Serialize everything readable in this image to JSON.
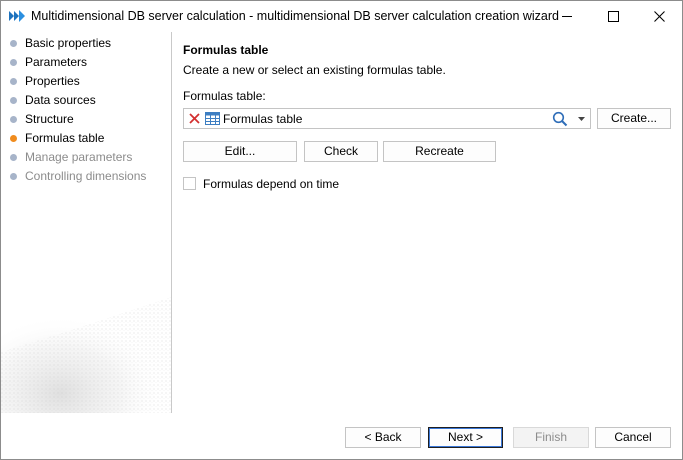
{
  "window": {
    "title": "Multidimensional DB server calculation - multidimensional DB server calculation creation wizard"
  },
  "nav": {
    "items": [
      {
        "label": "Basic properties",
        "state": "normal"
      },
      {
        "label": "Parameters",
        "state": "normal"
      },
      {
        "label": "Properties",
        "state": "normal"
      },
      {
        "label": "Data sources",
        "state": "normal"
      },
      {
        "label": "Structure",
        "state": "normal"
      },
      {
        "label": "Formulas table",
        "state": "active"
      },
      {
        "label": "Manage parameters",
        "state": "disabled"
      },
      {
        "label": "Controlling dimensions",
        "state": "disabled"
      }
    ]
  },
  "main": {
    "title": "Formulas table",
    "description": "Create a new or select an existing formulas table.",
    "field_label": "Formulas table:",
    "combo_value": "Formulas table",
    "create_label": "Create...",
    "edit_label": "Edit...",
    "check_label": "Check",
    "recreate_label": "Recreate",
    "checkbox_label": "Formulas depend on time",
    "checkbox_checked": false
  },
  "footer": {
    "back_label": "< Back",
    "next_label": "Next >",
    "finish_label": "Finish",
    "cancel_label": "Cancel"
  },
  "colors": {
    "active_dot": "#f08c1e",
    "normal_dot": "#a7b4c9",
    "clear_icon": "#d32f2f",
    "app_icon": "#1e73be",
    "default_button_border": "#3b78d8"
  }
}
